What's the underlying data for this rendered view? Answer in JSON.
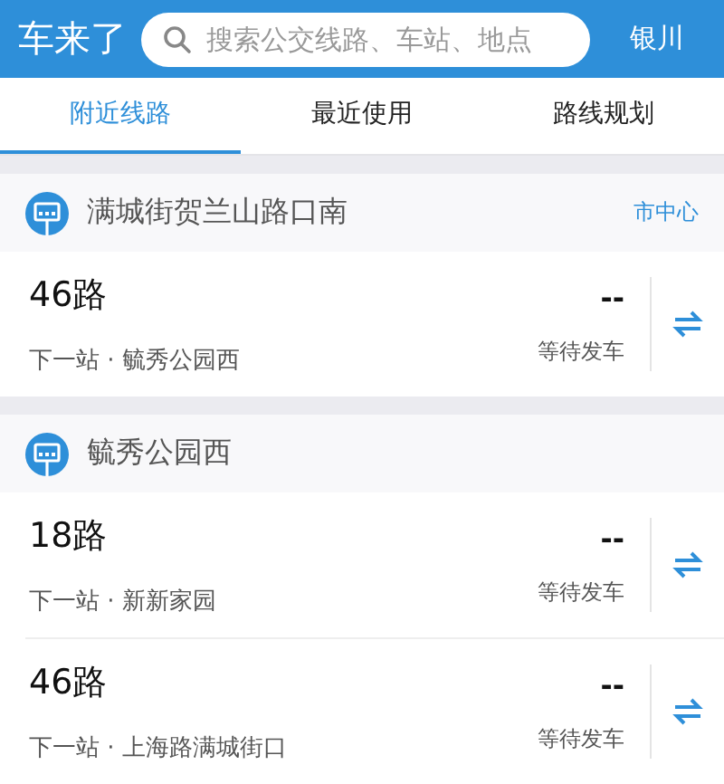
{
  "header": {
    "app_title": "车来了",
    "search": {
      "placeholder": "搜索公交线路、车站、地点"
    },
    "city": "银川"
  },
  "tabs": [
    {
      "label": "附近线路",
      "selected": true
    },
    {
      "label": "最近使用",
      "selected": false
    },
    {
      "label": "路线规划",
      "selected": false
    }
  ],
  "stations": [
    {
      "name": "满城街贺兰山路口南",
      "area": "市中心",
      "routes": [
        {
          "line": "46路",
          "next_stop": "下一站 · 毓秀公园西",
          "eta": "--",
          "status": "等待发车"
        }
      ]
    },
    {
      "name": "毓秀公园西",
      "routes": [
        {
          "line": "18路",
          "next_stop": "下一站 · 新新家园",
          "eta": "--",
          "status": "等待发车"
        },
        {
          "line": "46路",
          "next_stop": "下一站 · 上海路满城街口",
          "eta": "--",
          "status": "等待发车"
        }
      ]
    }
  ]
}
